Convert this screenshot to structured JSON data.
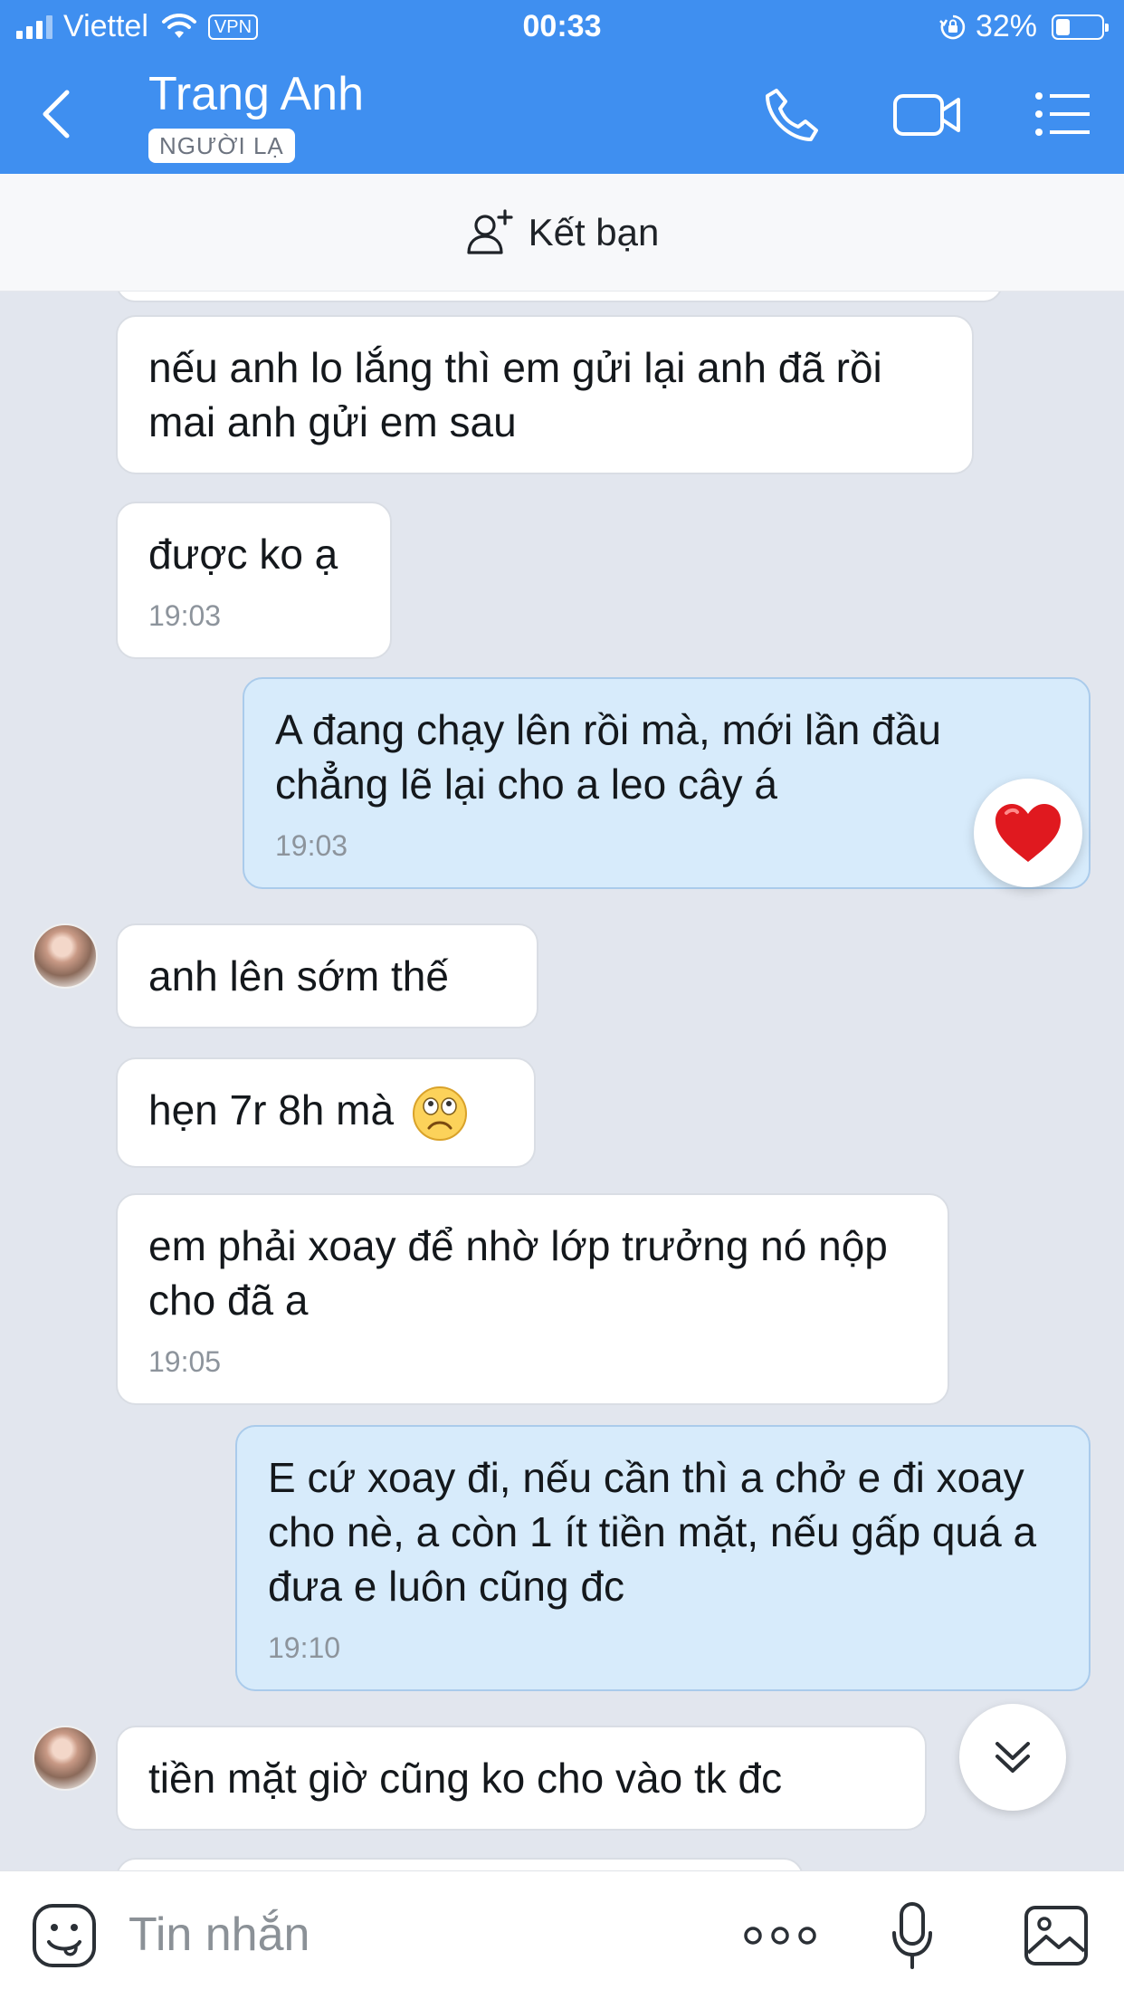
{
  "status_bar": {
    "carrier": "Viettel",
    "vpn": "VPN",
    "time": "00:33",
    "battery": "32%",
    "battery_level": 0.32
  },
  "header": {
    "contact_name": "Trang Anh",
    "stranger_badge": "NGƯỜI LẠ"
  },
  "friend_bar": {
    "label": "Kết bạn"
  },
  "messages": [
    {
      "side": "in",
      "text": "nếu anh lo lắng thì em gửi lại anh đã rồi mai anh gửi em sau",
      "time": ""
    },
    {
      "side": "in",
      "text": "được ko ạ",
      "time": "19:03"
    },
    {
      "side": "out",
      "text": "A đang chạy lên rồi mà, mới lần đầu chẳng lẽ lại cho a leo cây á",
      "time": "19:03",
      "reaction": "heart"
    },
    {
      "side": "in",
      "text": "anh lên sớm thế",
      "time": ""
    },
    {
      "side": "in",
      "text": "hẹn 7r 8h mà",
      "time": "",
      "emoji": "sad-face"
    },
    {
      "side": "in",
      "text": "em phải xoay để nhờ lớp trưởng nó nộp cho đã a",
      "time": "19:05"
    },
    {
      "side": "out",
      "text": "E cứ xoay đi, nếu cần thì a chở e đi xoay cho nè, a còn 1 ít tiền mặt, nếu gấp quá a đưa e luôn cũng đc",
      "time": "19:10"
    },
    {
      "side": "in",
      "text": "tiền mặt giờ cũng ko cho vào tk đc",
      "time": ""
    }
  ],
  "input": {
    "placeholder": "Tin nhắn"
  },
  "icons": {
    "back": "chevron-left-icon",
    "call": "phone-icon",
    "video": "video-camera-icon",
    "menu": "list-menu-icon",
    "add_friend": "add-user-icon",
    "sticker": "sticker-face-icon",
    "more": "more-dots-icon",
    "mic": "microphone-icon",
    "image": "image-icon",
    "scroll": "double-chevron-down-icon"
  },
  "colors": {
    "header_blue": "#3f8ff0",
    "outgoing_bubble": "#d7ebfb",
    "incoming_bubble": "#ffffff",
    "chat_background": "#e2e6ee"
  }
}
